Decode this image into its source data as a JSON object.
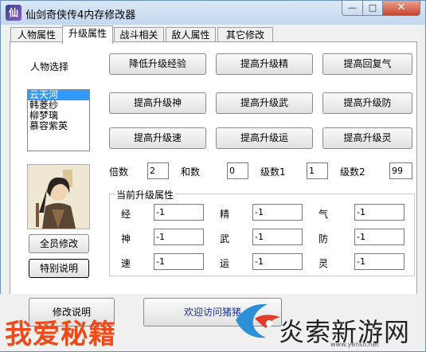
{
  "window": {
    "title": "仙剑奇侠传4内存修改器",
    "app_icon_char": "仙",
    "minimize_glyph": "—",
    "maximize_glyph": "□",
    "close_glyph": "✕"
  },
  "tabs": [
    {
      "label": "人物属性",
      "active": false
    },
    {
      "label": "升级属性",
      "active": true
    },
    {
      "label": "战斗相关",
      "active": false
    },
    {
      "label": "敌人属性",
      "active": false
    },
    {
      "label": "其它修改",
      "active": false
    }
  ],
  "character_select_label": "人物选择",
  "characters": [
    "云天河",
    "韩菱纱",
    "柳梦璃",
    "慕容紫英"
  ],
  "selected_character": "云天河",
  "buttons": {
    "reduce_exp": "降低升级经验",
    "raise_jing_up": "提高升级精",
    "raise_huifu": "提高回复气",
    "raise_shen_up": "提高升级神",
    "raise_wu_up": "提高升级武",
    "raise_fang_up": "提高升级防",
    "raise_su_up": "提高升级速",
    "raise_yun_up": "提高升级运",
    "raise_ling_up": "提高升级灵",
    "all_modify": "全员修改",
    "special_note": "特别说明",
    "modify_note": "修改说明",
    "visit": "欢迎访问猪猪"
  },
  "params": {
    "multiplier_label": "倍数",
    "multiplier_value": "2",
    "sum_label": "和数",
    "sum_value": "0",
    "level1_label": "级数1",
    "level1_value": "1",
    "level2_label": "级数2",
    "level2_value": "99"
  },
  "current_attrs": {
    "title": "当前升级属性",
    "rows": [
      [
        {
          "label": "经",
          "value": "-1"
        },
        {
          "label": "精",
          "value": "-1"
        },
        {
          "label": "气",
          "value": "-1"
        }
      ],
      [
        {
          "label": "神",
          "value": "-1"
        },
        {
          "label": "武",
          "value": "-1"
        },
        {
          "label": "防",
          "value": "-1"
        }
      ],
      [
        {
          "label": "速",
          "value": "-1"
        },
        {
          "label": "运",
          "value": "-1"
        },
        {
          "label": "灵",
          "value": "-1"
        }
      ]
    ]
  },
  "watermark": {
    "left_text": "我爱秘籍",
    "right_text": "炎索新游网",
    "url": "www.yenso.net"
  },
  "colors": {
    "selection": "#3399ff",
    "watermark_red": "#f04a1b",
    "close_red": "#c7442c"
  }
}
